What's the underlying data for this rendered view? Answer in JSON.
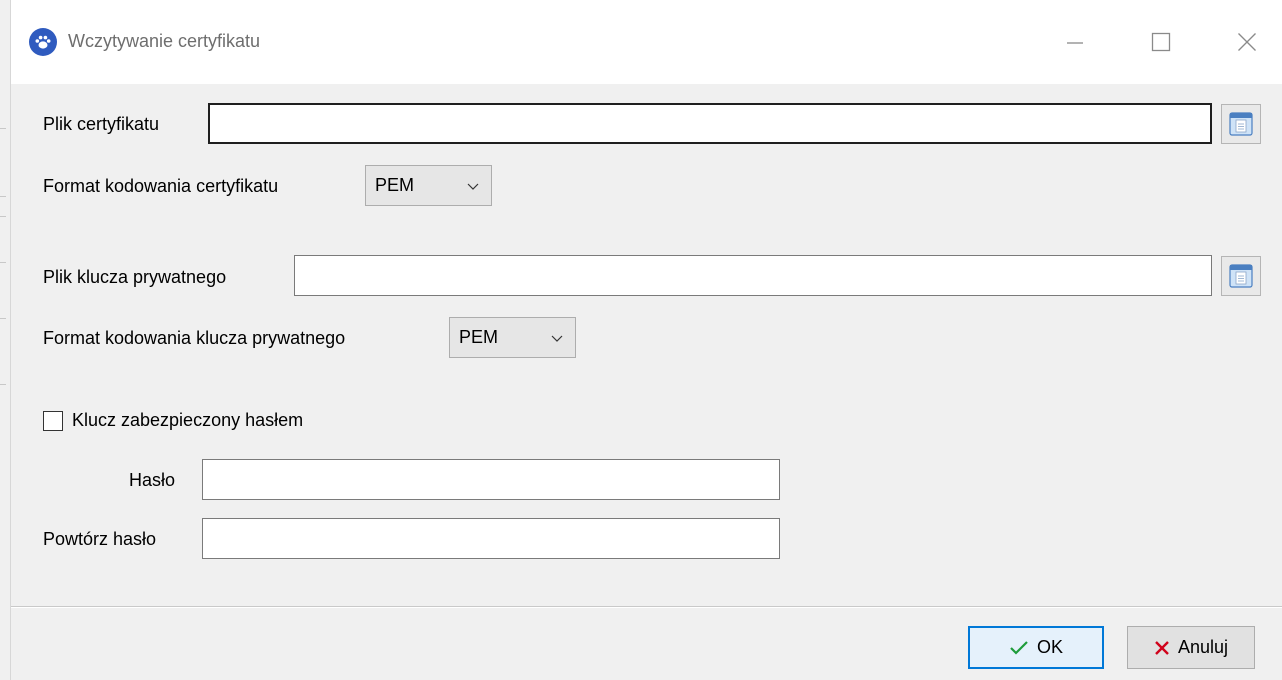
{
  "window": {
    "title": "Wczytywanie certyfikatu",
    "controls": [
      "minimize-icon",
      "maximize-icon",
      "close-icon"
    ]
  },
  "form": {
    "cert_file": {
      "label": "Plik certyfikatu",
      "value": ""
    },
    "cert_format": {
      "label": "Format kodowania certyfikatu",
      "selected": "PEM"
    },
    "key_file": {
      "label": "Plik klucza prywatnego",
      "value": ""
    },
    "key_format": {
      "label": "Format kodowania klucza prywatnego",
      "selected": "PEM"
    },
    "password_protected": {
      "label": "Klucz zabezpieczony hasłem",
      "checked": false
    },
    "password": {
      "label": "Hasło",
      "value": ""
    },
    "password_repeat": {
      "label": "Powtórz hasło",
      "value": ""
    }
  },
  "footer": {
    "ok_label": "OK",
    "cancel_label": "Anuluj"
  },
  "colors": {
    "accent": "#0078d7",
    "ok_check": "#1e9c3a",
    "cancel_x": "#d0021b",
    "app_icon": "#2f5bbf"
  }
}
